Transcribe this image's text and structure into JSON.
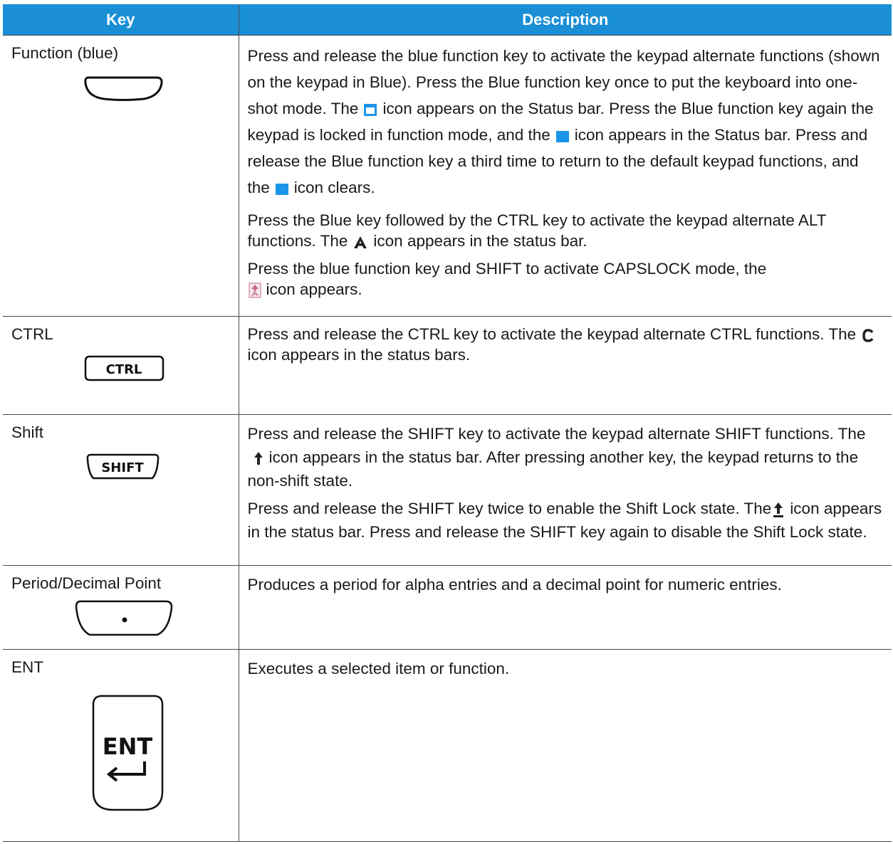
{
  "table": {
    "header": {
      "key": "Key",
      "description": "Description"
    },
    "rows": [
      {
        "key": "Function (blue)",
        "paras": [
          {
            "s1": "Press and release the blue function key to activate the keypad alternate functions (shown on the keypad in Blue). Press the Blue function key once to put the keyboard into one-shot mode. The",
            "s2": "icon appears on the Status bar. Press the Blue function key again the keypad is locked in function mode, and the",
            "s3": "icon appears in the Status bar. Press and release the Blue function key a third time to return to the default keypad functions, and the",
            "s4": "icon clears."
          },
          {
            "s1": "Press the Blue key followed by the CTRL key to activate the keypad alternate ALT functions. The",
            "s2": "icon appears in the status bar."
          },
          {
            "s1": "Press the blue function key and SHIFT to activate CAPSLOCK mode, the",
            "s2": "icon appears."
          }
        ]
      },
      {
        "key": "CTRL",
        "keycap": "CTRL",
        "paras": [
          {
            "s1": "Press and release the CTRL key to activate the keypad alternate CTRL functions. The",
            "s2": "icon appears in the status bars."
          }
        ]
      },
      {
        "key": "Shift",
        "keycap": "SHIFT",
        "paras": [
          {
            "s1": "Press and release the SHIFT key to activate the keypad alternate SHIFT functions. The",
            "s2": "icon appears in the status bar. After pressing another key, the keypad returns to the non-shift state."
          },
          {
            "s1": "Press and release the SHIFT key twice to enable the Shift Lock state. The",
            "s2": "icon appears in the status bar. Press and release the SHIFT key again to disable the Shift Lock state."
          }
        ]
      },
      {
        "key": "Period/Decimal Point",
        "paras": [
          {
            "s1": "Produces a period for alpha entries and a decimal point for numeric entries."
          }
        ]
      },
      {
        "key": "ENT",
        "keycap": "ENT",
        "paras": [
          {
            "s1": "Executes a selected item or function."
          }
        ]
      }
    ]
  },
  "icons": {
    "blue_function_oneshot": "blue-outline-square-icon",
    "blue_function_locked": "blue-filled-square-icon",
    "alt_status": "letter-a-icon",
    "capslock_status": "capslock-icon",
    "ctrl_status": "letter-c-icon",
    "shift_status": "up-arrow-icon",
    "shift_lock_status": "underlined-up-arrow-icon",
    "enter_arrow": "enter-arrow-icon"
  },
  "colors": {
    "header_bg": "#1a8fd6",
    "header_text": "#ffffff",
    "status_blue": "#1b95e8",
    "capslock_pink": "#c86a8a"
  }
}
